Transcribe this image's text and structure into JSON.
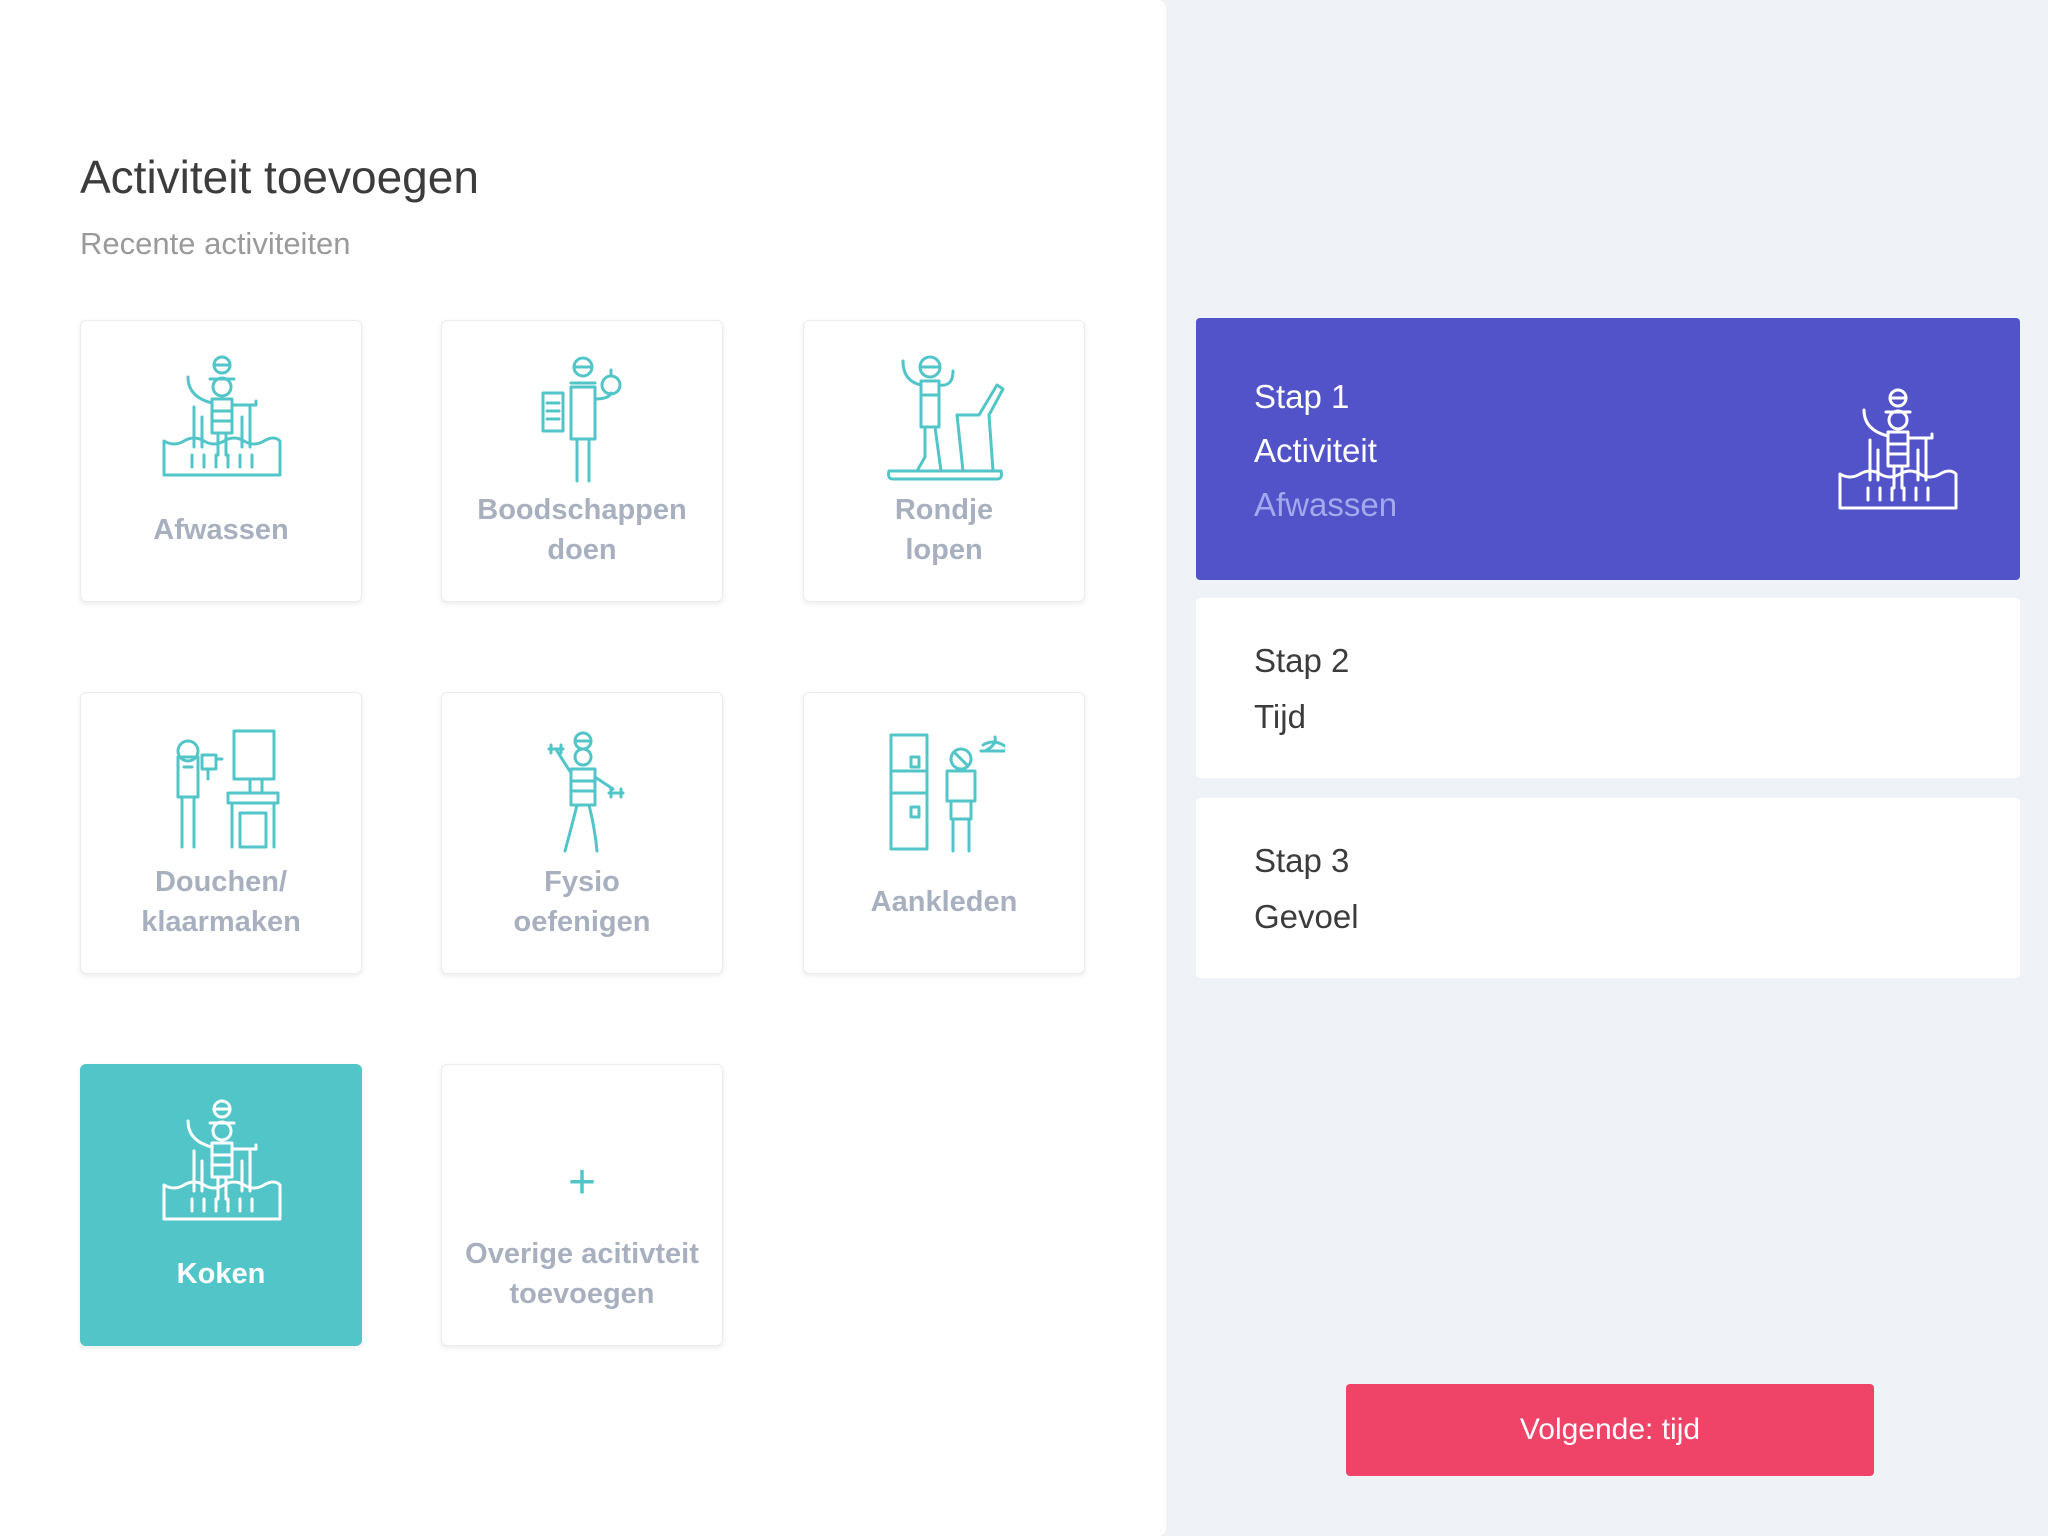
{
  "header": {
    "title": "Activiteit toevoegen",
    "subtitle": "Recente activiteiten"
  },
  "activities": [
    {
      "label": "Afwassen",
      "icon": "washing-dishes-icon"
    },
    {
      "label": "Boodschappen\ndoen",
      "icon": "groceries-icon"
    },
    {
      "label": "Rondje\nlopen",
      "icon": "treadmill-walk-icon"
    },
    {
      "label": "Douchen/\nklaarmaken",
      "icon": "hairdryer-mirror-icon"
    },
    {
      "label": "Fysio\noefenigen",
      "icon": "dumbbell-exercise-icon"
    },
    {
      "label": "Aankleden",
      "icon": "wardrobe-dressing-icon"
    },
    {
      "label": "Koken",
      "icon": "washing-dishes-icon",
      "selected": true
    },
    {
      "label": "Overige acitivteit\ntoevoegen",
      "icon": "plus-icon"
    }
  ],
  "add_symbol": "+",
  "steps": [
    {
      "number": "Stap 1",
      "name": "Activiteit",
      "value": "Afwassen",
      "active": true
    },
    {
      "number": "Stap 2",
      "name": "Tijd"
    },
    {
      "number": "Stap 3",
      "name": "Gevoel"
    }
  ],
  "next_button": "Volgende: tijd",
  "colors": {
    "accent_teal": "#52c5c9",
    "step_active": "#5253c9",
    "step_value_muted": "#a3a9ec",
    "button": "#ef4468",
    "tile_label": "#a8b0bf",
    "background": "#eff2f7"
  }
}
